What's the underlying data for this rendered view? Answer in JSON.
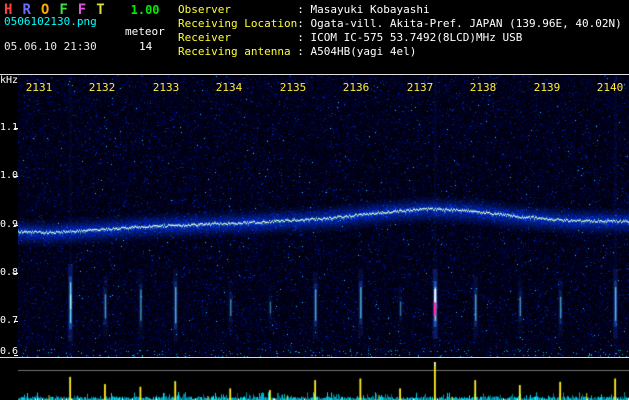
{
  "header": {
    "app": {
      "letters": [
        {
          "ch": "H",
          "color": "#ff4040"
        },
        {
          "ch": "R",
          "color": "#6b6bff"
        },
        {
          "ch": "O",
          "color": "#ffaa00"
        },
        {
          "ch": "F",
          "color": "#44dd44"
        },
        {
          "ch": "F",
          "color": "#dd55dd"
        },
        {
          "ch": "T",
          "color": "#dddd44"
        }
      ],
      "version": "1.00",
      "version_color": "#00ee00"
    },
    "filename": "0506102130.png",
    "filename_color": "#00ffff",
    "mode": "meteor",
    "datetime": "05.06.10 21:30",
    "count": "14",
    "colon": ": ",
    "label_color": "#ffff33",
    "value_color": "#ffffff",
    "fields": [
      {
        "label": "Observer",
        "value": "Masayuki Kobayashi"
      },
      {
        "label": "Receiving Location",
        "value": "Ogata-vill. Akita-Pref. JAPAN (139.96E, 40.02N)"
      },
      {
        "label": "Receiver",
        "value": "ICOM IC-575 53.7492(8LCD)MHz USB"
      },
      {
        "label": "Receiving antenna",
        "value": "A504HB(yagi 4el)"
      }
    ]
  },
  "chart_data": {
    "type": "heatmap",
    "x_axis": {
      "labels": [
        "2131",
        "2132",
        "2133",
        "2134",
        "2135",
        "2136",
        "2137",
        "2138",
        "2139",
        "2140"
      ]
    },
    "y_axis": {
      "unit": "kHz",
      "labels": [
        "1.1",
        "1.0",
        "0.9",
        "0.8",
        "0.7",
        "0.6"
      ],
      "range_khz": [
        0.625,
        1.21
      ]
    },
    "colors": {
      "noise": "#0000aa",
      "carrier": "#baffc8",
      "echo": "#55ddff",
      "strong_echo": "#ff2fa8",
      "spike": "#ffee22",
      "baseline": "#00e5ff",
      "time_label": "#ffee33"
    },
    "carrier_trace": {
      "points": [
        [
          0,
          0.885
        ],
        [
          0.05,
          0.883
        ],
        [
          0.12,
          0.888
        ],
        [
          0.2,
          0.895
        ],
        [
          0.3,
          0.9
        ],
        [
          0.4,
          0.905
        ],
        [
          0.5,
          0.912
        ],
        [
          0.6,
          0.925
        ],
        [
          0.67,
          0.932
        ],
        [
          0.74,
          0.928
        ],
        [
          0.82,
          0.916
        ],
        [
          0.9,
          0.908
        ],
        [
          1,
          0.906
        ]
      ]
    },
    "echoes": [
      {
        "t": 0.085,
        "f_hi": 0.78,
        "f_lo": 0.695,
        "intensity": 0.8,
        "spike": 0.55
      },
      {
        "t": 0.142,
        "f_hi": 0.755,
        "f_lo": 0.705,
        "intensity": 0.35,
        "spike": 0.33
      },
      {
        "t": 0.2,
        "f_hi": 0.765,
        "f_lo": 0.7,
        "intensity": 0.3,
        "spike": 0.25
      },
      {
        "t": 0.257,
        "f_hi": 0.77,
        "f_lo": 0.695,
        "intensity": 0.5,
        "spike": 0.42
      },
      {
        "t": 0.347,
        "f_hi": 0.745,
        "f_lo": 0.71,
        "intensity": 0.25,
        "spike": 0.2
      },
      {
        "t": 0.412,
        "f_hi": 0.74,
        "f_lo": 0.715,
        "intensity": 0.15,
        "spike": 0.15
      },
      {
        "t": 0.486,
        "f_hi": 0.765,
        "f_lo": 0.7,
        "intensity": 0.45,
        "spike": 0.45
      },
      {
        "t": 0.56,
        "f_hi": 0.77,
        "f_lo": 0.705,
        "intensity": 0.5,
        "spike": 0.5
      },
      {
        "t": 0.625,
        "f_hi": 0.74,
        "f_lo": 0.71,
        "intensity": 0.15,
        "spike": 0.2
      },
      {
        "t": 0.682,
        "f_hi": 0.77,
        "f_lo": 0.7,
        "intensity": 1.0,
        "spike": 1.0
      },
      {
        "t": 0.748,
        "f_hi": 0.755,
        "f_lo": 0.7,
        "intensity": 0.4,
        "spike": 0.45
      },
      {
        "t": 0.821,
        "f_hi": 0.75,
        "f_lo": 0.71,
        "intensity": 0.3,
        "spike": 0.3
      },
      {
        "t": 0.887,
        "f_hi": 0.75,
        "f_lo": 0.705,
        "intensity": 0.35,
        "spike": 0.4
      },
      {
        "t": 0.977,
        "f_hi": 0.77,
        "f_lo": 0.7,
        "intensity": 0.6,
        "spike": 0.5
      }
    ],
    "minor_spikes": [
      0.05,
      0.31,
      0.44,
      0.59,
      0.71,
      0.93
    ]
  }
}
